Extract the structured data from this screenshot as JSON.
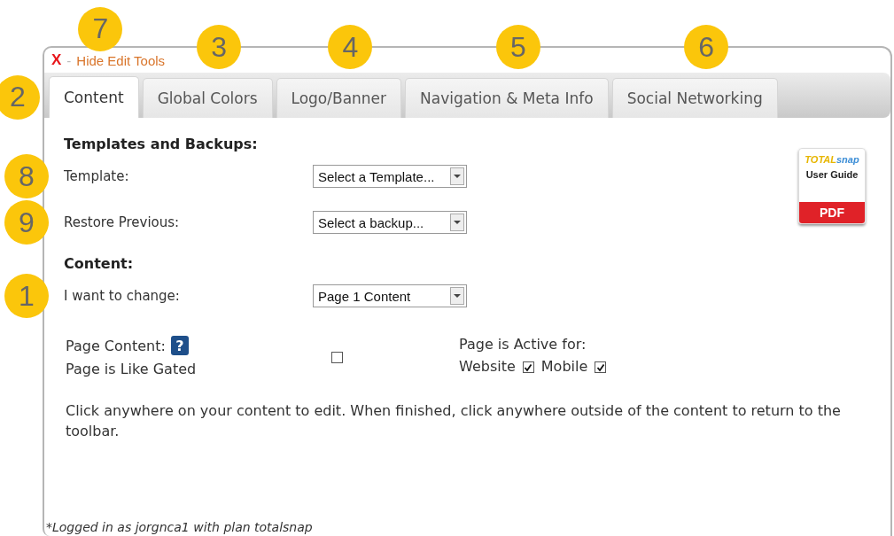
{
  "toolbar": {
    "close": "X",
    "separator": "-",
    "hide_tools": "Hide Edit Tools",
    "callout": "7"
  },
  "tabs": [
    {
      "label": "Content",
      "selected": true,
      "callout": "2"
    },
    {
      "label": "Global Colors",
      "selected": false,
      "callout": "3"
    },
    {
      "label": "Logo/Banner",
      "selected": false,
      "callout": "4"
    },
    {
      "label": "Navigation & Meta Info",
      "selected": false,
      "callout": "5"
    },
    {
      "label": "Social Networking",
      "selected": false,
      "callout": "6"
    }
  ],
  "sections": [
    {
      "heading": "Templates and Backups:",
      "rows": [
        {
          "label": "Template:",
          "value": "Select a Template...",
          "callout": "8"
        },
        {
          "label": "Restore Previous:",
          "value": "Select a backup...",
          "callout": "9"
        }
      ]
    },
    {
      "heading": "Content:",
      "rows": [
        {
          "label": "I want to change:",
          "value": "Page 1 Content",
          "callout": "1"
        }
      ]
    }
  ],
  "guide": {
    "brand_prefix": "TOTAL",
    "brand_suffix": "snap",
    "label": "User Guide",
    "format": "PDF"
  },
  "page_content": {
    "label": "Page Content:",
    "help": "?"
  },
  "like_gated": {
    "label": "Page is Like Gated",
    "checked": false
  },
  "active_for": {
    "label": "Page is Active for:",
    "options": [
      {
        "label": "Website",
        "checked": true
      },
      {
        "label": "Mobile",
        "checked": true
      }
    ]
  },
  "instructions": "Click anywhere on your content to edit. When finished, click anywhere outside of the content to return to the toolbar.",
  "footer": "*Logged in as jorgnca1 with plan totalsnap"
}
